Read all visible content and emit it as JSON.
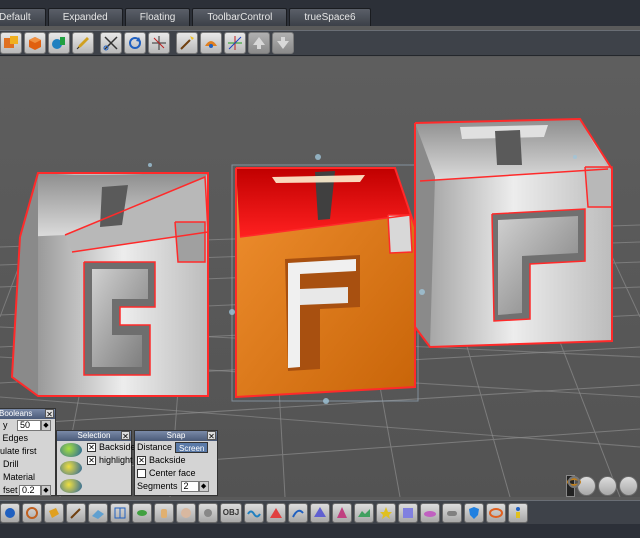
{
  "tabs": [
    {
      "label": "Default"
    },
    {
      "label": "Expanded"
    },
    {
      "label": "Floating"
    },
    {
      "label": "ToolbarControl"
    },
    {
      "label": "trueSpace6"
    }
  ],
  "toolbar_icons": [
    "object-tool-icon",
    "cube-icon",
    "paint-icon",
    "pencil-icon",
    "scissors-icon",
    "rotate-icon",
    "move-axes-icon",
    "magic-wand-icon",
    "deform-icon",
    "axes-icon",
    "arrow-up-icon",
    "arrow-down-icon"
  ],
  "booleans_panel": {
    "title": "Booleans",
    "density_label": "y",
    "density_value": "50",
    "edges_label": "e Edges",
    "triangulate_label": "gulate first",
    "drill_label": "Drill",
    "material_label": "Material",
    "offset_label": "fset",
    "offset_value": "0.2"
  },
  "selection_panel": {
    "title": "Selection",
    "backside_label": "Backside",
    "highlight_label": "highlight"
  },
  "snap_panel": {
    "title": "Snap",
    "distance_label": "Distance",
    "screen_label": "Screen",
    "backside_label": "Backside",
    "center_face_label": "Center face",
    "segments_label": "Segments",
    "segments_value": "2"
  },
  "bottom_obj_label": "OBJ",
  "colors": {
    "selection_outline": "#ff2a2a",
    "orange_cube": "#e87a10",
    "grid": "#7c7c7c"
  }
}
